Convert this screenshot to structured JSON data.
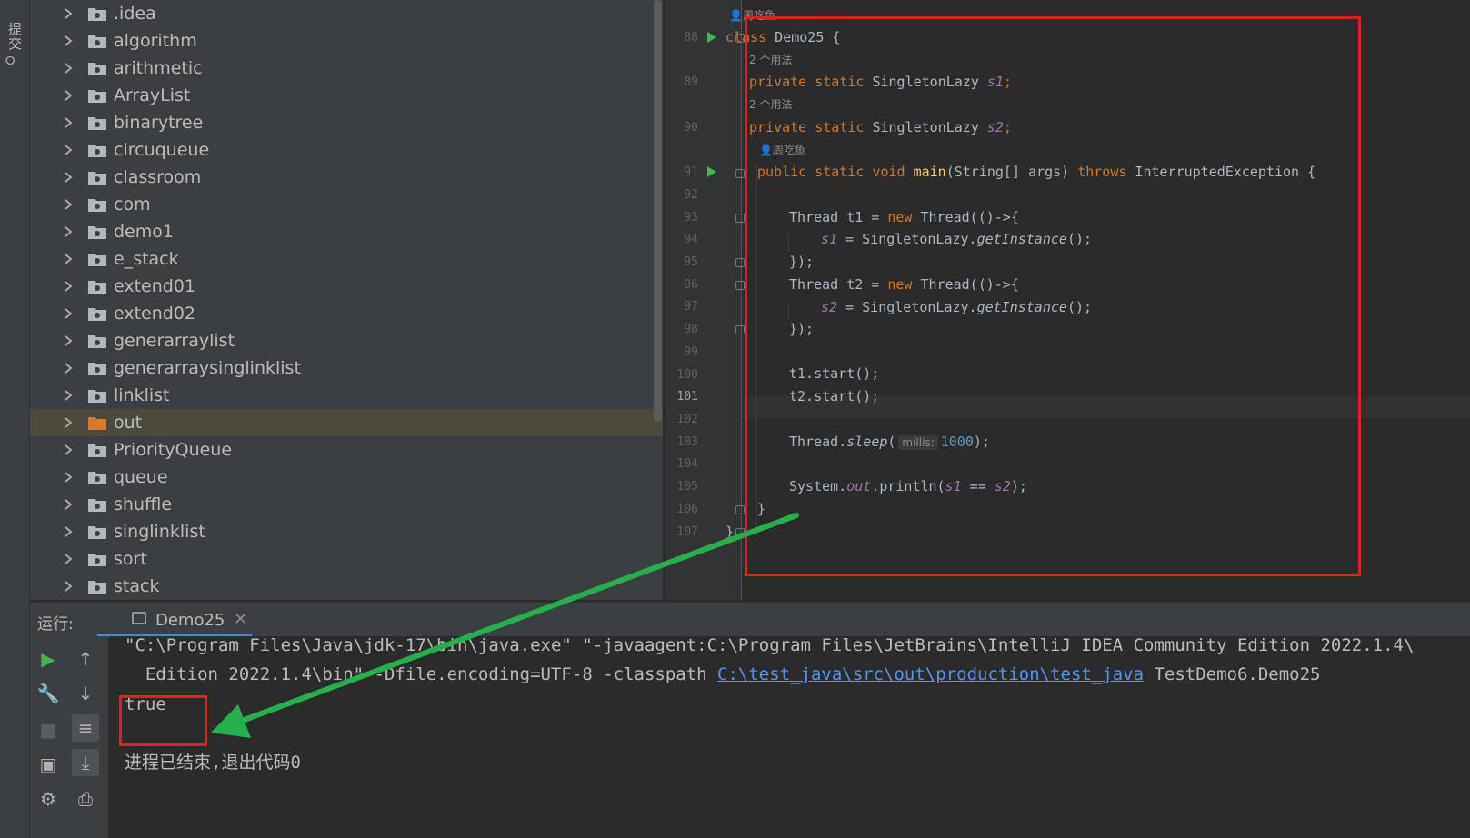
{
  "left_strip": {
    "commit_label": "提交"
  },
  "project_tree": {
    "items": [
      {
        "name": ".idea"
      },
      {
        "name": "algorithm"
      },
      {
        "name": "arithmetic"
      },
      {
        "name": "ArrayList"
      },
      {
        "name": "binarytree"
      },
      {
        "name": "circuqueue"
      },
      {
        "name": "classroom"
      },
      {
        "name": "com"
      },
      {
        "name": "demo1"
      },
      {
        "name": "e_stack"
      },
      {
        "name": "extend01"
      },
      {
        "name": "extend02"
      },
      {
        "name": "generarraylist"
      },
      {
        "name": "generarraysinglinklist"
      },
      {
        "name": "linklist"
      },
      {
        "name": "out",
        "selected": true,
        "color": "#d67b2a"
      },
      {
        "name": "PriorityQueue"
      },
      {
        "name": "queue"
      },
      {
        "name": "shuffle"
      },
      {
        "name": "singlinklist"
      },
      {
        "name": "sort"
      },
      {
        "name": "stack"
      }
    ]
  },
  "editor": {
    "line_numbers": [
      "88",
      "89",
      "90",
      "91",
      "92",
      "93",
      "94",
      "95",
      "96",
      "97",
      "98",
      "99",
      "100",
      "101",
      "102",
      "103",
      "104",
      "105",
      "106",
      "107"
    ],
    "current_line": "101",
    "hints": {
      "author_top": "周吃鱼",
      "usages_s1": "2 个用法",
      "usages_s2": "2 个用法",
      "author_main": "周吃鱼",
      "param_millis": "millis:"
    },
    "code": {
      "l88": {
        "kw": "class",
        "rest": " Demo25 {"
      },
      "l89": {
        "kw": "private static",
        "type": " SingletonLazy ",
        "field": "s1",
        "end": ";"
      },
      "l90": {
        "kw": "private static",
        "type": " SingletonLazy ",
        "field": "s2",
        "end": ";"
      },
      "l91": {
        "kw1": "public static void",
        "fn": " main",
        "mid": "(String[] args) ",
        "kw2": "throws",
        "rest": " InterruptedException {"
      },
      "l93": {
        "a": "Thread t1 = ",
        "kw": "new",
        "b": " Thread(()->{"
      },
      "l94": {
        "field": "s1",
        "a": " = SingletonLazy.",
        "it": "getInstance",
        "b": "();"
      },
      "l95": {
        "a": "});"
      },
      "l96": {
        "a": "Thread t2 = ",
        "kw": "new",
        "b": " Thread(()->{"
      },
      "l97": {
        "field": "s2",
        "a": " = SingletonLazy.",
        "it": "getInstance",
        "b": "();"
      },
      "l98": {
        "a": "});"
      },
      "l100": {
        "a": "t1.start();"
      },
      "l101": {
        "a": "t2.start();"
      },
      "l103": {
        "a": "Thread.",
        "it": "sleep",
        "b": "(",
        "num": "1000",
        "c": ");"
      },
      "l105": {
        "a": "System.",
        "out": "out",
        "b": ".println(",
        "f1": "s1",
        "c": " == ",
        "f2": "s2",
        "d": ");"
      },
      "l106": {
        "a": "}"
      },
      "l107": {
        "a": "}"
      }
    }
  },
  "run_panel": {
    "label": "运行:",
    "tab_label": "Demo25",
    "console": {
      "line1": "\"C:\\Program Files\\Java\\jdk-17\\bin\\java.exe\" \"-javaagent:C:\\Program Files\\JetBrains\\IntelliJ IDEA Community Edition 2022.1.4\\",
      "line2_prefix": "  Edition 2022.1.4\\bin\" -Dfile.encoding=UTF-8 -classpath ",
      "line2_link": "C:\\test_java\\src\\out\\production\\test_java",
      "line2_suffix": " TestDemo6.Demo25",
      "output": "true",
      "exit_message": "进程已结束,退出代码0"
    }
  },
  "colors": {
    "highlight_box": "#e02020",
    "arrow": "#22b14c",
    "keyword": "#cc7832",
    "field": "#9876aa",
    "function": "#ffc66d",
    "number": "#6897bb",
    "link": "#5394ec"
  }
}
